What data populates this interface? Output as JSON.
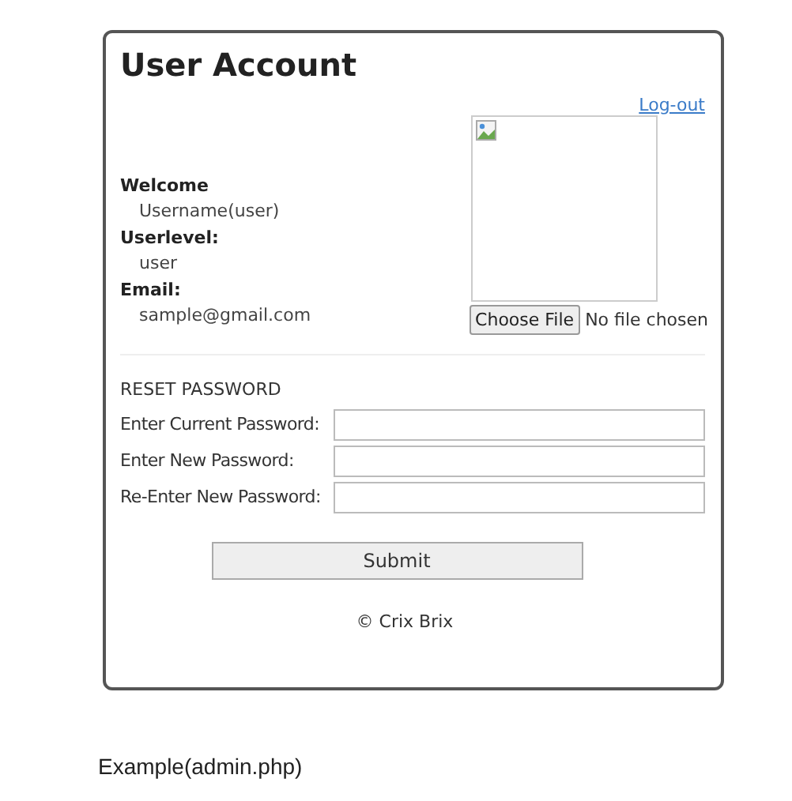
{
  "card": {
    "title": "User Account",
    "logout": "Log-out",
    "profile": [
      {
        "label": "Welcome",
        "value": "Username(user)"
      },
      {
        "label": "Userlevel:",
        "value": "user"
      },
      {
        "label": "Email:",
        "value": "sample@gmail.com"
      }
    ],
    "file_button": "Choose File",
    "file_status": "No file chosen",
    "reset": {
      "heading": "RESET PASSWORD",
      "fields": [
        {
          "label": "Enter Current Password:"
        },
        {
          "label": "Enter New Password:"
        },
        {
          "label": "Re-Enter New Password:"
        }
      ],
      "submit": "Submit"
    },
    "footer": "© Crix Brix"
  },
  "caption": "Example(admin.php)"
}
